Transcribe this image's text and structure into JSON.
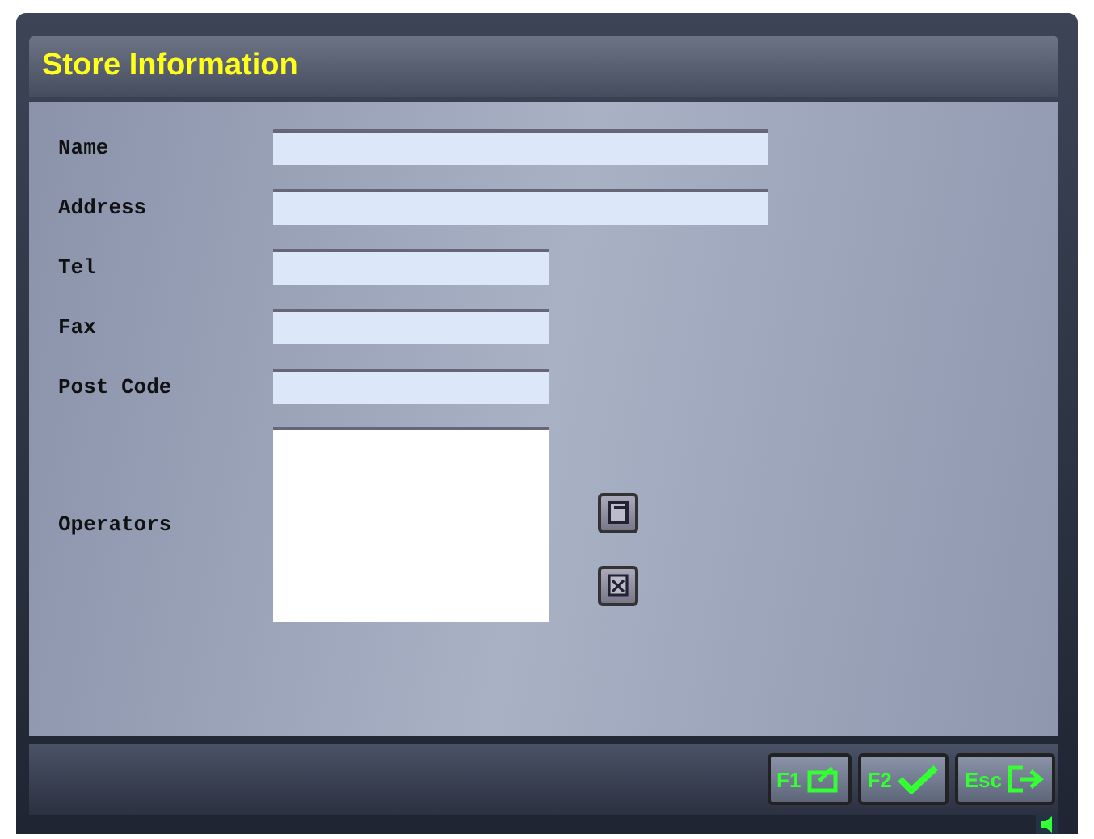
{
  "window": {
    "title": "Store Information"
  },
  "fields": [
    {
      "label": "Name",
      "kind": "wide"
    },
    {
      "label": "Address",
      "kind": "wide"
    },
    {
      "label": "Tel",
      "kind": "narrow"
    },
    {
      "label": "Fax",
      "kind": "narrow"
    },
    {
      "label": "Post Code",
      "kind": "narrow"
    }
  ],
  "operators": {
    "label": "Operators"
  },
  "buttons": [
    {
      "key": "F1",
      "kind": "edit"
    },
    {
      "key": "F2",
      "kind": "ok"
    },
    {
      "key": "Esc",
      "kind": "exit"
    }
  ]
}
